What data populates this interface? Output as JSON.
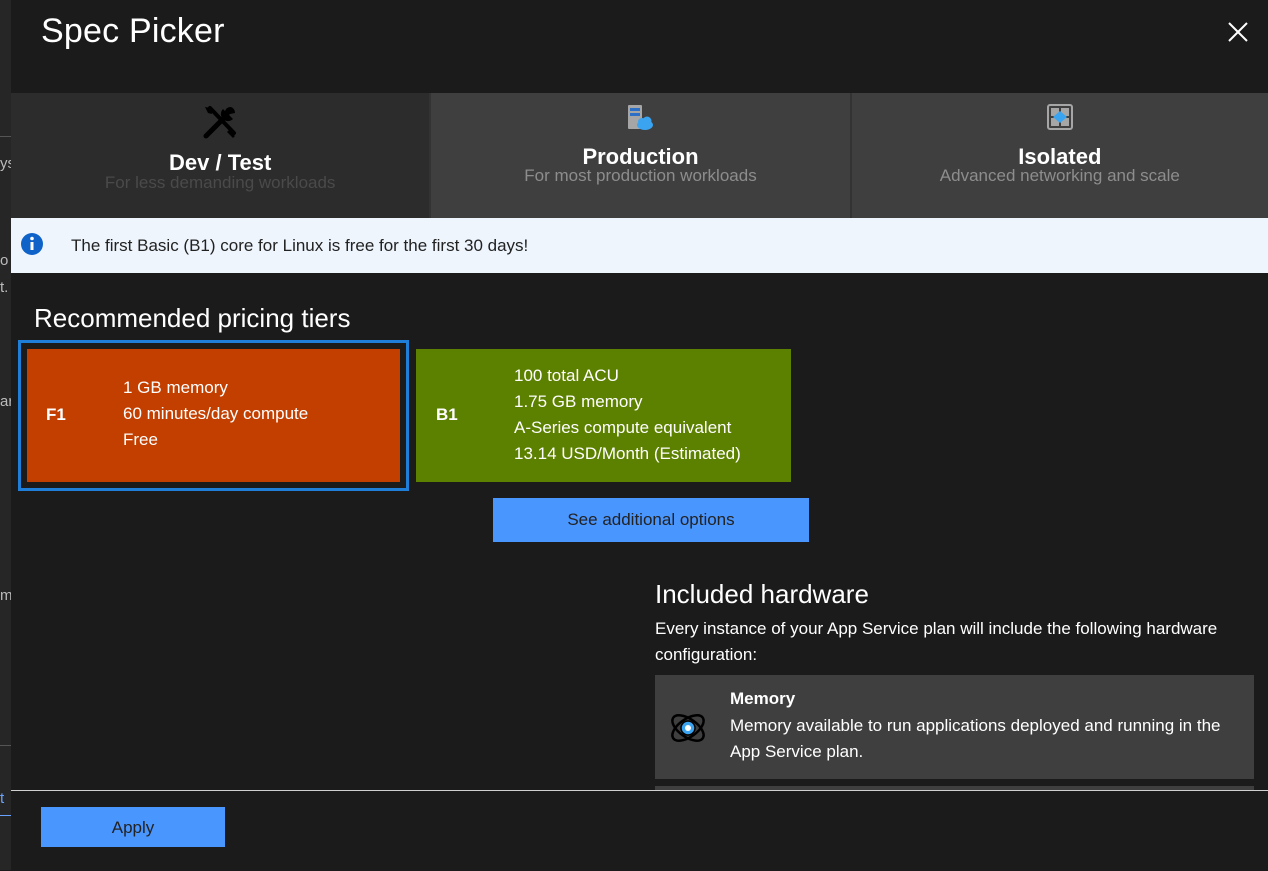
{
  "background_fragments": [
    "ys",
    "o",
    "t.",
    "ar",
    "m",
    "t"
  ],
  "header": {
    "title": "Spec Picker"
  },
  "tabs": [
    {
      "name": "Dev / Test",
      "subtitle": "For less demanding workloads",
      "icon": "tools-icon",
      "selected": true
    },
    {
      "name": "Production",
      "subtitle": "For most production workloads",
      "icon": "server-cloud-icon",
      "selected": false
    },
    {
      "name": "Isolated",
      "subtitle": "Advanced networking and scale",
      "icon": "isolated-network-icon",
      "selected": false
    }
  ],
  "info_banner": {
    "message": "The first Basic (B1) core for Linux is free for the first 30 days!",
    "icon": "info-icon"
  },
  "recommended": {
    "title": "Recommended pricing tiers",
    "tiers": [
      {
        "id": "F1",
        "lines": [
          "1 GB memory",
          "60 minutes/day compute",
          "Free"
        ],
        "color": "#c33f00",
        "selected": true
      },
      {
        "id": "B1",
        "lines": [
          "100 total ACU",
          "1.75 GB memory",
          "A-Series compute equivalent",
          "13.14 USD/Month (Estimated)"
        ],
        "color": "#5c8000",
        "selected": false
      }
    ],
    "see_more_label": "See additional options"
  },
  "hardware": {
    "title": "Included hardware",
    "description": "Every instance of your App Service plan will include the following hardware configuration:",
    "items": [
      {
        "name": "Memory",
        "text": "Memory available to run applications deployed and running in the App Service plan.",
        "icon": "memory-icon"
      }
    ]
  },
  "footer": {
    "apply_label": "Apply"
  },
  "colors": {
    "accent": "#4a96ff",
    "selected_outline": "#1f7fd8",
    "panel_bg": "#1b1b1b",
    "info_bg": "#eef5fd"
  }
}
